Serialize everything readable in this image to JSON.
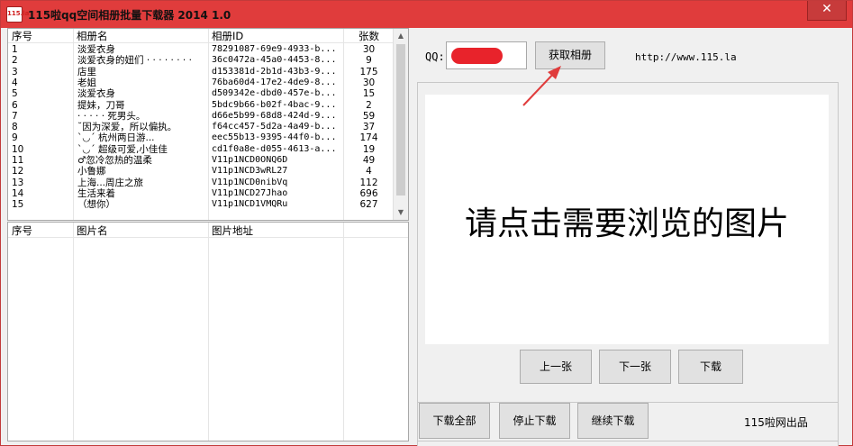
{
  "window": {
    "title": "115啦qq空间相册批量下载器 2014 1.0",
    "app_icon_text": "115.la",
    "close_glyph": "✕",
    "accent": "#e03c3c"
  },
  "album_list": {
    "headers": [
      "序号",
      "相册名",
      "相册ID",
      "张数"
    ],
    "rows": [
      {
        "no": "1",
        "name": "淡爱衣身",
        "id": "78291087-69e9-4933-b...",
        "count": "30"
      },
      {
        "no": "2",
        "name": "淡爱衣身的妞们 · · · · · · · ·",
        "id": "36c0472a-45a0-4453-8...",
        "count": "9"
      },
      {
        "no": "3",
        "name": "店里",
        "id": "d153381d-2b1d-43b3-9...",
        "count": "175"
      },
      {
        "no": "4",
        "name": "老姐",
        "id": "76ba60d4-17e2-4de9-8...",
        "count": "30"
      },
      {
        "no": "5",
        "name": "淡爱衣身",
        "id": "d509342e-dbd0-457e-b...",
        "count": "15"
      },
      {
        "no": "6",
        "name": "提妹，刀哥",
        "id": "5bdc9b66-b02f-4bac-9...",
        "count": "2"
      },
      {
        "no": "7",
        "name": "· · · · · 死男头。",
        "id": "d66e5b99-68d8-424d-9...",
        "count": "59"
      },
      {
        "no": "8",
        "name": "˘因为深爱，所以偏执。",
        "id": "f64cc457-5d2a-4a49-b...",
        "count": "37"
      },
      {
        "no": "9",
        "name": "ˋ◡ˊ 杭州两日游...",
        "id": "eec55b13-9395-44f0-b...",
        "count": "174"
      },
      {
        "no": "10",
        "name": "ˋ◡ˊ 超级可爱,小佳佳",
        "id": "cd1f0a8e-d055-4613-a...",
        "count": "19"
      },
      {
        "no": "11",
        "name": "♂忽冷忽热的温柔",
        "id": "V11p1NCD0ONQ6D",
        "count": "49"
      },
      {
        "no": "12",
        "name": "小鲁娜",
        "id": "V11p1NCD3wRL27",
        "count": "4"
      },
      {
        "no": "13",
        "name": "上海...周庄之旅",
        "id": "V11p1NCD0nibVq",
        "count": "112"
      },
      {
        "no": "14",
        "name": "生活来着",
        "id": "V11p1NCD27Jhao",
        "count": "696"
      },
      {
        "no": "15",
        "name": "（想你）",
        "id": "V11p1NCD1VMQRu",
        "count": "627"
      }
    ]
  },
  "photo_list": {
    "headers": [
      "序号",
      "图片名",
      "图片地址"
    ]
  },
  "qq": {
    "label": "QQ:",
    "redaction_color": "#e8232b"
  },
  "buttons": {
    "get_albums": "获取相册",
    "prev": "上一张",
    "next": "下一张",
    "download": "下载",
    "download_all": "下载全部",
    "stop_download": "停止下载",
    "resume_download": "继续下载"
  },
  "url": "http://www.115.la",
  "preview": {
    "prompt": "请点击需要浏览的图片"
  },
  "credit": "115啦网出品",
  "annotation": {
    "arrow_color": "#e03c3c"
  }
}
